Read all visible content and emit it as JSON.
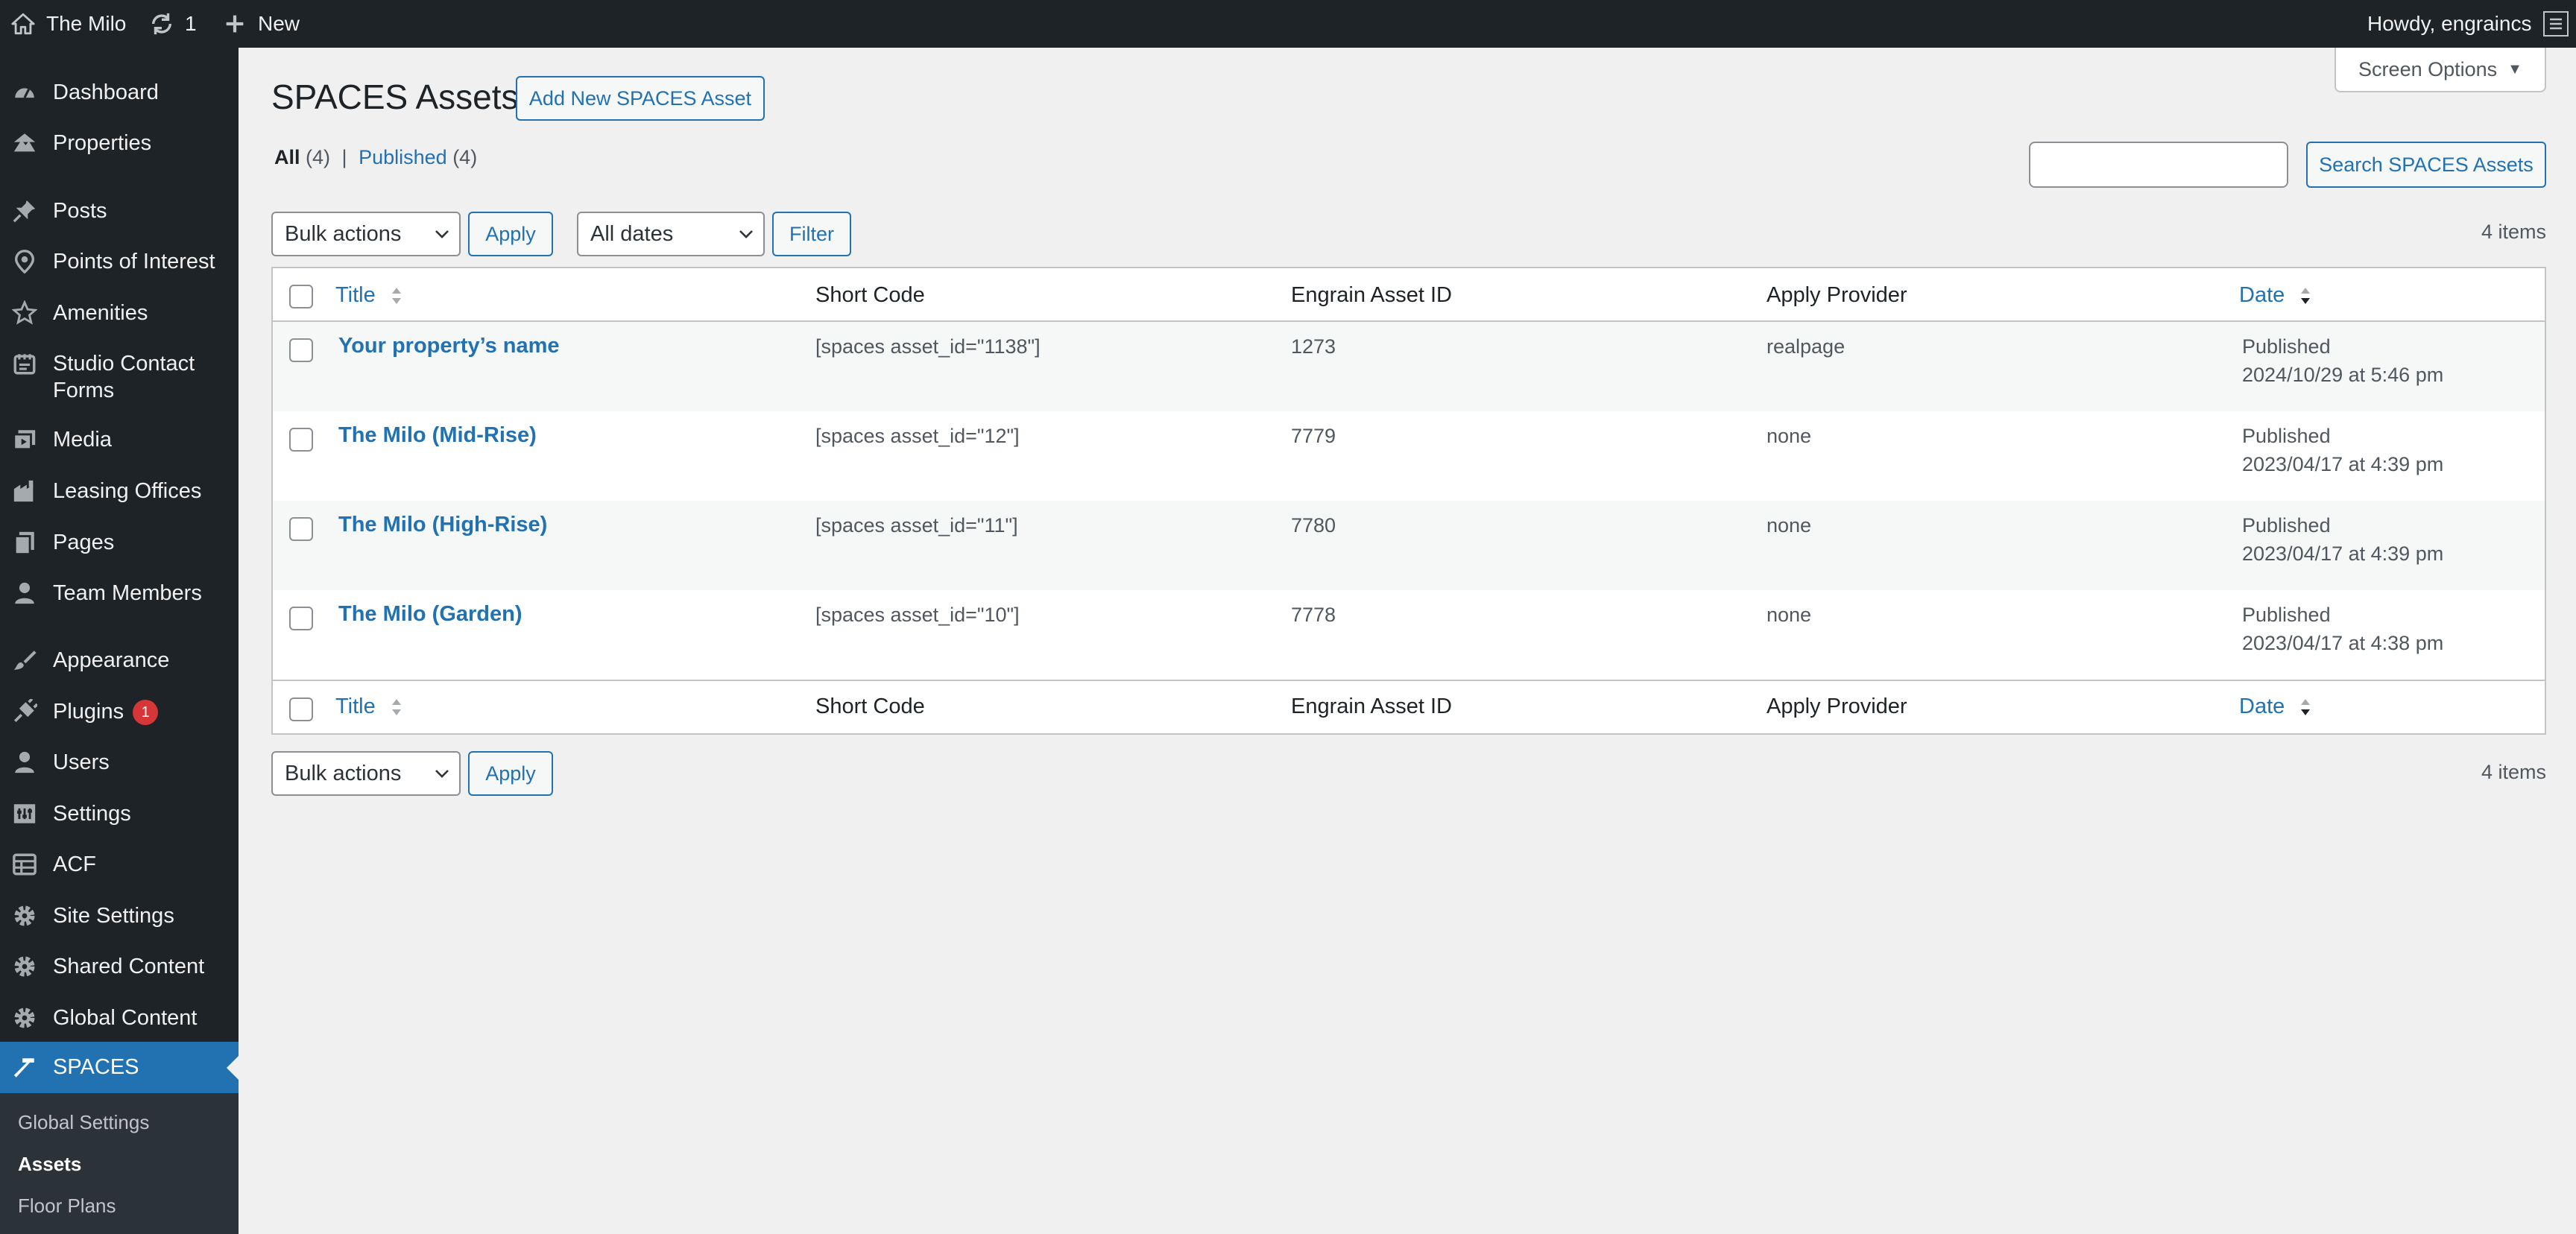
{
  "colors": {
    "accent": "#2271b1",
    "adminbar": "#1d2327",
    "badge": "#d63638"
  },
  "adminbar": {
    "site_name": "The Milo",
    "updates_count": "1",
    "new_label": "New",
    "greeting": "Howdy, engraincs"
  },
  "sidebar": {
    "items": [
      {
        "label": "Dashboard",
        "icon": "dashboard-icon"
      },
      {
        "label": "Properties",
        "icon": "properties-icon"
      },
      {
        "label": "Posts",
        "icon": "pushpin-icon"
      },
      {
        "label": "Points of Interest",
        "icon": "location-pin-icon"
      },
      {
        "label": "Amenities",
        "icon": "star-icon"
      },
      {
        "label": "Studio Contact Forms",
        "icon": "forms-icon"
      },
      {
        "label": "Media",
        "icon": "media-icon"
      },
      {
        "label": "Leasing Offices",
        "icon": "office-icon"
      },
      {
        "label": "Pages",
        "icon": "pages-icon"
      },
      {
        "label": "Team Members",
        "icon": "person-icon"
      },
      {
        "label": "Appearance",
        "icon": "paintbrush-icon"
      },
      {
        "label": "Plugins",
        "icon": "plugin-icon",
        "badge": "1"
      },
      {
        "label": "Users",
        "icon": "users-icon"
      },
      {
        "label": "Settings",
        "icon": "settings-icon"
      },
      {
        "label": "ACF",
        "icon": "acf-icon"
      },
      {
        "label": "Site Settings",
        "icon": "gear-icon"
      },
      {
        "label": "Shared Content",
        "icon": "gear-icon"
      },
      {
        "label": "Global Content",
        "icon": "gear-icon"
      },
      {
        "label": "SPACES",
        "icon": "hammer-icon",
        "current": true
      }
    ],
    "submenu": [
      "Global Settings",
      "Assets",
      "Floor Plans"
    ]
  },
  "header": {
    "screen_options": "Screen Options",
    "page_title": "SPACES Assets",
    "add_new": "Add New SPACES Asset"
  },
  "views": {
    "all_label": "All",
    "all_count": "(4)",
    "separator": "|",
    "published_label": "Published",
    "published_count": "(4)"
  },
  "search": {
    "value": "",
    "button": "Search SPACES Assets"
  },
  "tablenav": {
    "bulk_actions": "Bulk actions",
    "apply": "Apply",
    "dates": "All dates",
    "filter": "Filter",
    "items_count": "4 items"
  },
  "table": {
    "columns": [
      "Title",
      "Short Code",
      "Engrain Asset ID",
      "Apply Provider",
      "Date"
    ],
    "rows": [
      {
        "title": "Your property’s name",
        "short_code": "[spaces asset_id=\"1138\"]",
        "asset_id": "1273",
        "provider": "realpage",
        "status": "Published",
        "date": "2024/10/29 at 5:46 pm"
      },
      {
        "title": "The Milo (Mid-Rise)",
        "short_code": "[spaces asset_id=\"12\"]",
        "asset_id": "7779",
        "provider": "none",
        "status": "Published",
        "date": "2023/04/17 at 4:39 pm"
      },
      {
        "title": "The Milo (High-Rise)",
        "short_code": "[spaces asset_id=\"11\"]",
        "asset_id": "7780",
        "provider": "none",
        "status": "Published",
        "date": "2023/04/17 at 4:39 pm"
      },
      {
        "title": "The Milo (Garden)",
        "short_code": "[spaces asset_id=\"10\"]",
        "asset_id": "7778",
        "provider": "none",
        "status": "Published",
        "date": "2023/04/17 at 4:38 pm"
      }
    ]
  }
}
